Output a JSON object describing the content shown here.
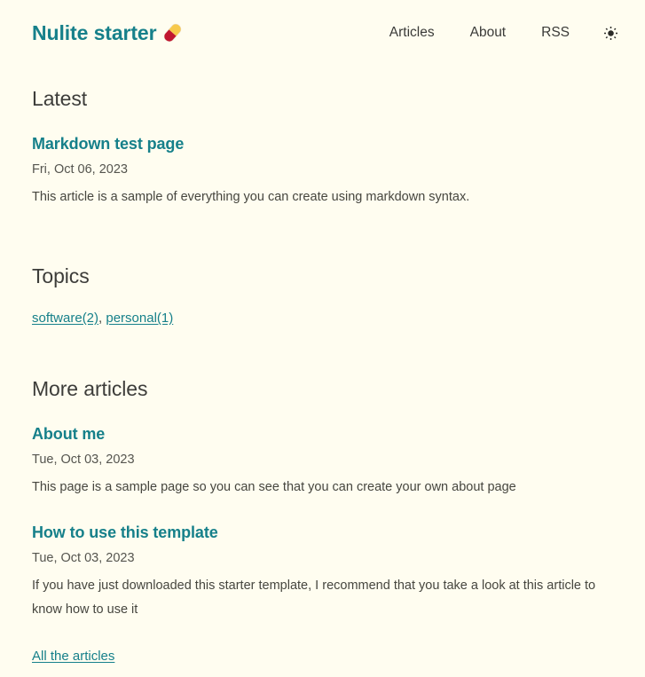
{
  "header": {
    "brand_title": "Nulite starter",
    "brand_emoji_name": "pill-emoji",
    "nav": [
      {
        "label": "Articles"
      },
      {
        "label": "About"
      },
      {
        "label": "RSS"
      }
    ],
    "theme_toggle_icon": "sun-icon"
  },
  "latest": {
    "heading": "Latest",
    "articles": [
      {
        "title": "Markdown test page",
        "date": "Fri, Oct 06, 2023",
        "excerpt": "This article is a sample of everything you can create using markdown syntax."
      }
    ]
  },
  "topics": {
    "heading": "Topics",
    "separator": ", ",
    "tags": [
      {
        "label": "software(2)"
      },
      {
        "label": "personal(1)"
      }
    ]
  },
  "more": {
    "heading": "More articles",
    "articles": [
      {
        "title": "About me",
        "date": "Tue, Oct 03, 2023",
        "excerpt": "This page is a sample page so you can see that you can create your own about page"
      },
      {
        "title": "How to use this template",
        "date": "Tue, Oct 03, 2023",
        "excerpt": "If you have just downloaded this starter template, I recommend that you take a look at this article to know how to use it"
      }
    ],
    "all_articles_label": "All the articles"
  },
  "colors": {
    "background": "#fffdf0",
    "accent_teal": "#16808a",
    "text": "#3d3d3a",
    "muted_text": "#55554f",
    "pill_top": "#f7c94b",
    "pill_bottom": "#c11630"
  }
}
